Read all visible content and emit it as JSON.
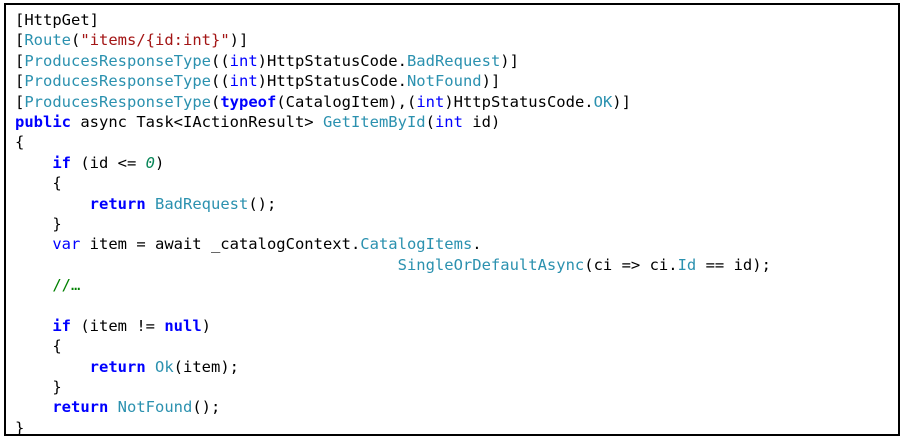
{
  "lines": [
    [
      {
        "t": "[HttpGet]",
        "c": "pl"
      }
    ],
    [
      {
        "t": "[",
        "c": "pl"
      },
      {
        "t": "Route",
        "c": "ty"
      },
      {
        "t": "(",
        "c": "pl"
      },
      {
        "t": "\"items/{id:int}\"",
        "c": "st"
      },
      {
        "t": ")]",
        "c": "pl"
      }
    ],
    [
      {
        "t": "[",
        "c": "pl"
      },
      {
        "t": "ProducesResponseType",
        "c": "ty"
      },
      {
        "t": "((",
        "c": "pl"
      },
      {
        "t": "int",
        "c": "kwn"
      },
      {
        "t": ")HttpStatusCode.",
        "c": "pl"
      },
      {
        "t": "BadRequest",
        "c": "me"
      },
      {
        "t": ")]",
        "c": "pl"
      }
    ],
    [
      {
        "t": "[",
        "c": "pl"
      },
      {
        "t": "ProducesResponseType",
        "c": "ty"
      },
      {
        "t": "((",
        "c": "pl"
      },
      {
        "t": "int",
        "c": "kwn"
      },
      {
        "t": ")HttpStatusCode.",
        "c": "pl"
      },
      {
        "t": "NotFound",
        "c": "me"
      },
      {
        "t": ")]",
        "c": "pl"
      }
    ],
    [
      {
        "t": "[",
        "c": "pl"
      },
      {
        "t": "ProducesResponseType",
        "c": "ty"
      },
      {
        "t": "(",
        "c": "pl"
      },
      {
        "t": "typeof",
        "c": "kw"
      },
      {
        "t": "(CatalogItem),(",
        "c": "pl"
      },
      {
        "t": "int",
        "c": "kwn"
      },
      {
        "t": ")HttpStatusCode.",
        "c": "pl"
      },
      {
        "t": "OK",
        "c": "me"
      },
      {
        "t": ")]",
        "c": "pl"
      }
    ],
    [
      {
        "t": "public",
        "c": "kw"
      },
      {
        "t": " async Task<IActionResult> ",
        "c": "pl"
      },
      {
        "t": "GetItemById",
        "c": "me"
      },
      {
        "t": "(",
        "c": "pl"
      },
      {
        "t": "int",
        "c": "kwn"
      },
      {
        "t": " id)",
        "c": "pl"
      }
    ],
    [
      {
        "t": "{",
        "c": "pl"
      }
    ],
    [
      {
        "t": "    ",
        "c": "pl"
      },
      {
        "t": "if",
        "c": "kw"
      },
      {
        "t": " (id <= ",
        "c": "pl"
      },
      {
        "t": "0",
        "c": "nu"
      },
      {
        "t": ")",
        "c": "pl"
      }
    ],
    [
      {
        "t": "    {",
        "c": "pl"
      }
    ],
    [
      {
        "t": "        ",
        "c": "pl"
      },
      {
        "t": "return",
        "c": "kw"
      },
      {
        "t": " ",
        "c": "pl"
      },
      {
        "t": "BadRequest",
        "c": "me"
      },
      {
        "t": "();",
        "c": "pl"
      }
    ],
    [
      {
        "t": "    }",
        "c": "pl"
      }
    ],
    [
      {
        "t": "    ",
        "c": "pl"
      },
      {
        "t": "var",
        "c": "kwn"
      },
      {
        "t": " item = await _catalogContext.",
        "c": "pl"
      },
      {
        "t": "CatalogItems",
        "c": "me"
      },
      {
        "t": ".",
        "c": "pl"
      }
    ],
    [
      {
        "t": "                                         ",
        "c": "pl"
      },
      {
        "t": "SingleOrDefaultAsync",
        "c": "me"
      },
      {
        "t": "(ci => ci.",
        "c": "pl"
      },
      {
        "t": "Id",
        "c": "me"
      },
      {
        "t": " == id);",
        "c": "pl"
      }
    ],
    [
      {
        "t": "    //…",
        "c": "cm"
      }
    ],
    [
      {
        "t": "",
        "c": "pl"
      }
    ],
    [
      {
        "t": "    ",
        "c": "pl"
      },
      {
        "t": "if",
        "c": "kw"
      },
      {
        "t": " (item != ",
        "c": "pl"
      },
      {
        "t": "null",
        "c": "kw"
      },
      {
        "t": ")",
        "c": "pl"
      }
    ],
    [
      {
        "t": "    {",
        "c": "pl"
      }
    ],
    [
      {
        "t": "        ",
        "c": "pl"
      },
      {
        "t": "return",
        "c": "kw"
      },
      {
        "t": " ",
        "c": "pl"
      },
      {
        "t": "Ok",
        "c": "me"
      },
      {
        "t": "(item);",
        "c": "pl"
      }
    ],
    [
      {
        "t": "    }",
        "c": "pl"
      }
    ],
    [
      {
        "t": "    ",
        "c": "pl"
      },
      {
        "t": "return",
        "c": "kw"
      },
      {
        "t": " ",
        "c": "pl"
      },
      {
        "t": "NotFound",
        "c": "me"
      },
      {
        "t": "();",
        "c": "pl"
      }
    ],
    [
      {
        "t": "}",
        "c": "pl"
      }
    ]
  ]
}
